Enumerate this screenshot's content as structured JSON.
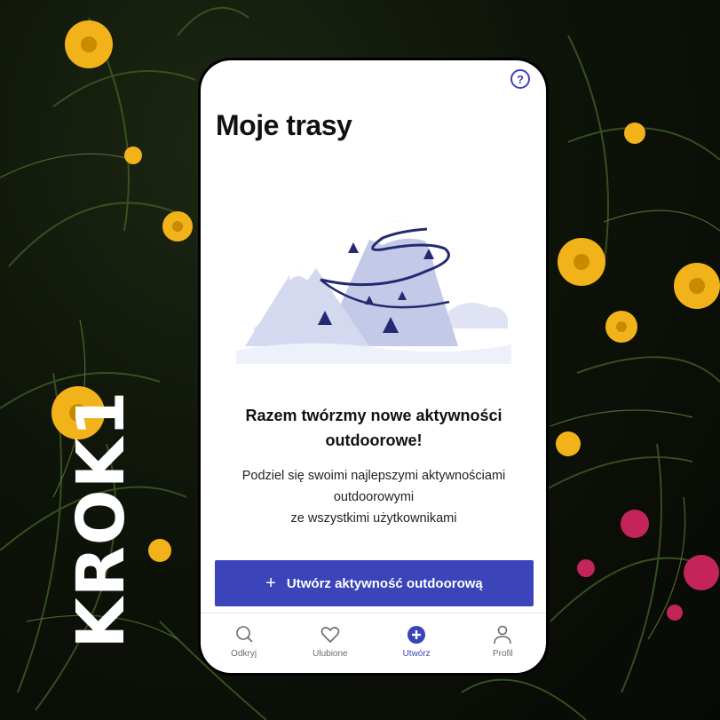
{
  "side_label": "KROK1",
  "header": {
    "title": "Moje trasy",
    "help_icon": "question-circle-icon"
  },
  "empty_state": {
    "illustration": "mountains-illustration",
    "headline": "Razem twórzmy nowe aktywności outdoorowe!",
    "body_lines": [
      "Podziel się swoimi najlepszymi aktywnościami",
      "outdoorowymi",
      "ze wszystkimi użytkownikami"
    ]
  },
  "cta": {
    "icon": "plus-icon",
    "label": "Utwórz aktywność outdoorową"
  },
  "bottom_nav": {
    "items": [
      {
        "label": "Odkryj",
        "icon": "search-icon",
        "active": false
      },
      {
        "label": "Ulubione",
        "icon": "heart-icon",
        "active": false
      },
      {
        "label": "Utwórz",
        "icon": "plus-circle-icon",
        "active": true
      },
      {
        "label": "Profil",
        "icon": "person-icon",
        "active": false
      }
    ]
  },
  "colors": {
    "accent": "#3b44b8",
    "background_dark": "#0d0f0a",
    "flower_yellow": "#f2b21a",
    "flower_pink": "#c4245a"
  }
}
